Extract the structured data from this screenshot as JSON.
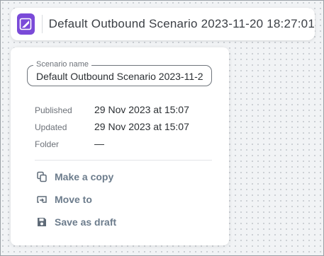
{
  "header": {
    "title": "Default Outbound Scenario 2023-11-20 18:27:01",
    "logo_icon": "pen-tool-icon",
    "logo_color": "#7a4ad8"
  },
  "panel": {
    "name_field": {
      "label": "Scenario name",
      "value": "Default Outbound Scenario 2023-11-2"
    },
    "meta": [
      {
        "label": "Published",
        "value": "29 Nov 2023 at 15:07"
      },
      {
        "label": "Updated",
        "value": "29 Nov 2023 at 15:07"
      },
      {
        "label": "Folder",
        "value": "—"
      }
    ],
    "actions": [
      {
        "label": "Make a copy",
        "icon": "copy-icon"
      },
      {
        "label": "Move to",
        "icon": "move-to-icon"
      },
      {
        "label": "Save as draft",
        "icon": "save-icon"
      }
    ]
  }
}
